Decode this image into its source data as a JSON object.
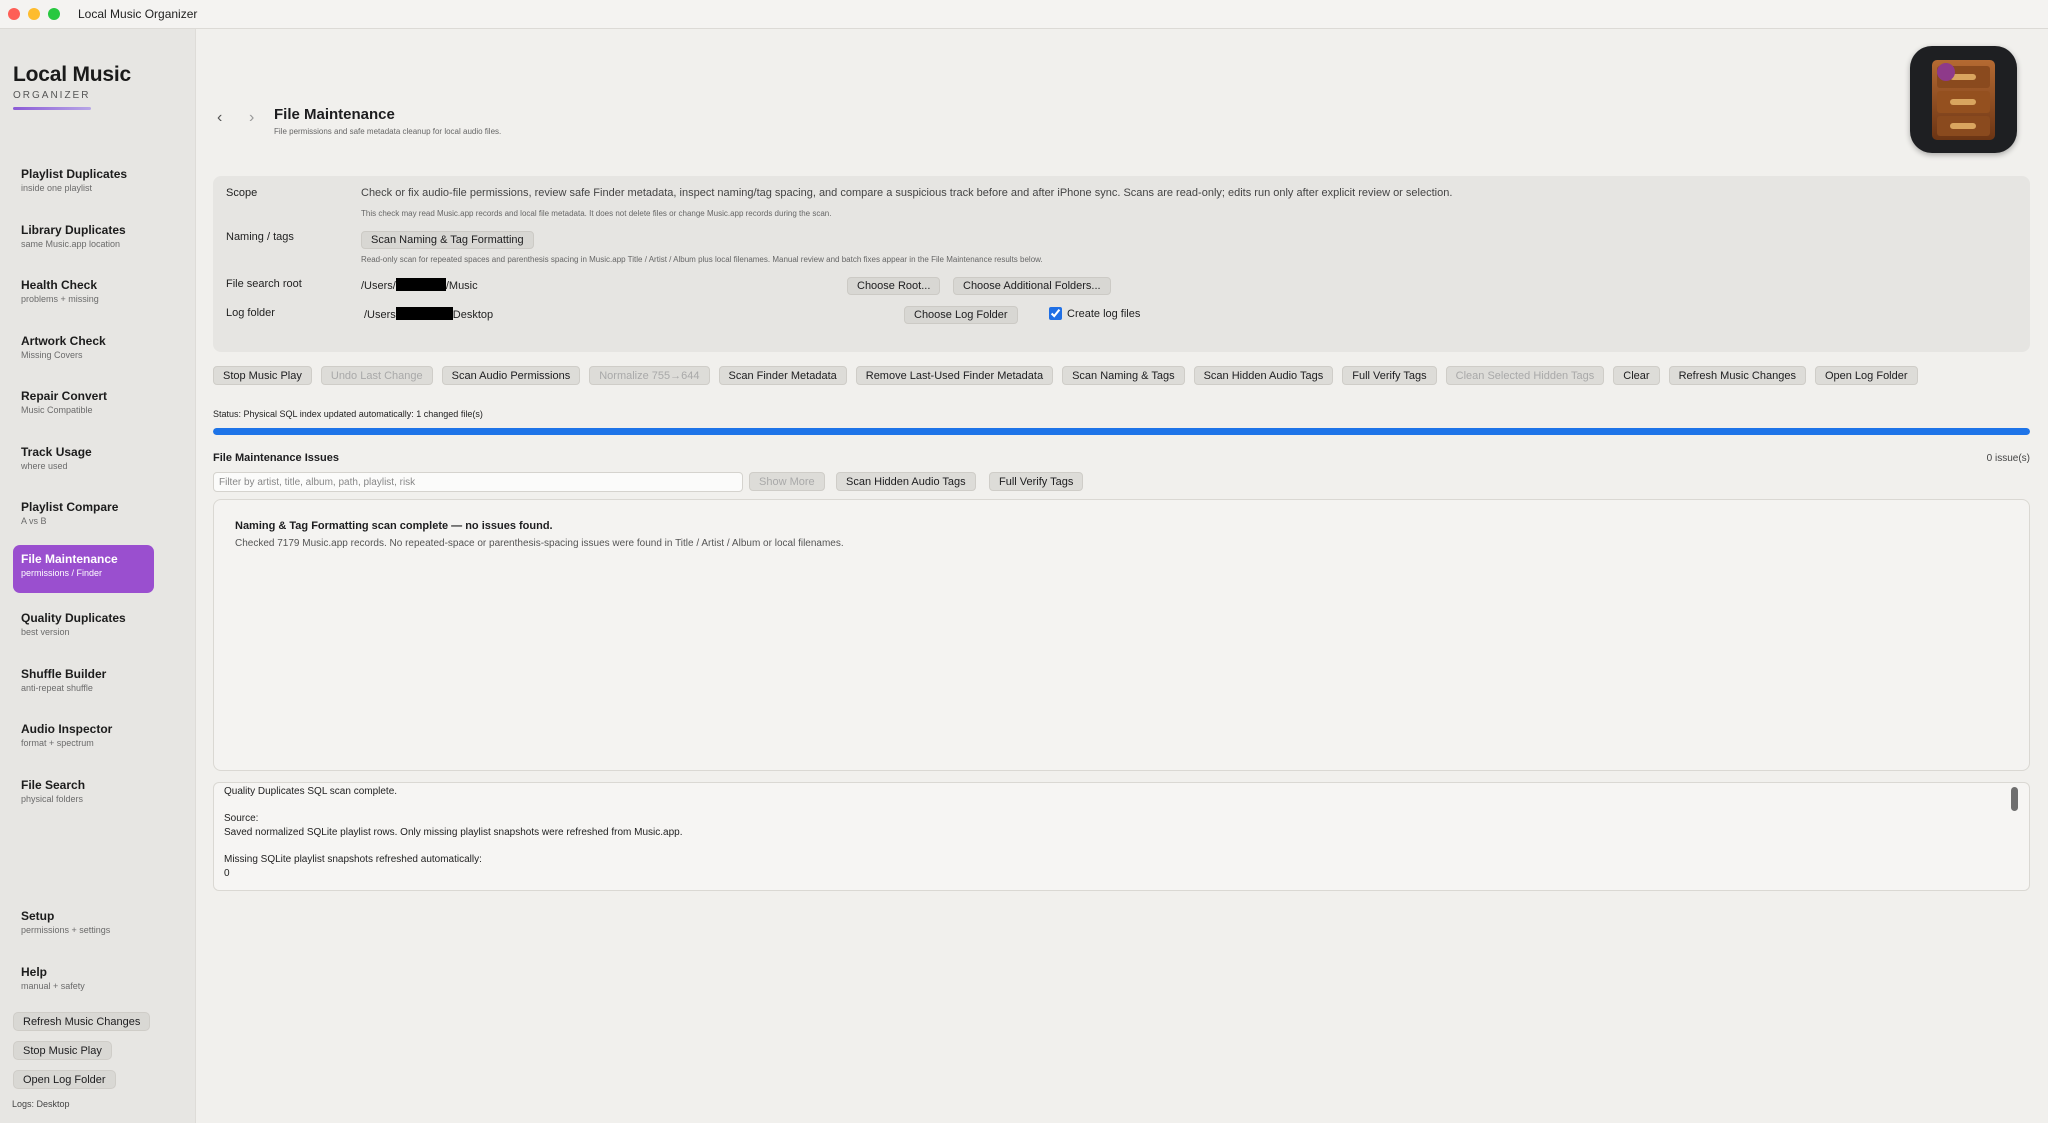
{
  "window": {
    "title": "Local Music Organizer"
  },
  "sidebar": {
    "brand_title": "Local Music",
    "brand_subtitle": "ORGANIZER",
    "items": [
      {
        "label": "Playlist Duplicates",
        "sub": "inside one playlist"
      },
      {
        "label": "Library Duplicates",
        "sub": "same Music.app location"
      },
      {
        "label": "Health Check",
        "sub": "problems + missing"
      },
      {
        "label": "Artwork Check",
        "sub": "Missing Covers"
      },
      {
        "label": "Repair Convert",
        "sub": "Music Compatible"
      },
      {
        "label": "Track Usage",
        "sub": "where used"
      },
      {
        "label": "Playlist Compare",
        "sub": "A vs B"
      },
      {
        "label": "File Maintenance",
        "sub": "permissions / Finder",
        "active": true
      },
      {
        "label": "Quality Duplicates",
        "sub": "best version"
      },
      {
        "label": "Shuffle Builder",
        "sub": "anti-repeat shuffle"
      },
      {
        "label": "Audio Inspector",
        "sub": "format + spectrum"
      },
      {
        "label": "File Search",
        "sub": "physical folders"
      }
    ],
    "footer_items": [
      {
        "label": "Setup",
        "sub": "permissions + settings"
      },
      {
        "label": "Help",
        "sub": "manual + safety"
      }
    ],
    "buttons": {
      "refresh": "Refresh Music Changes",
      "stop": "Stop Music Play",
      "open_log": "Open Log Folder"
    },
    "logs_label": "Logs: Desktop"
  },
  "header": {
    "title": "File Maintenance",
    "subtitle": "File permissions and safe metadata cleanup for local audio files.",
    "back_icon": "chevron-left-icon",
    "forward_icon": "chevron-right-icon"
  },
  "scope_panel": {
    "scope_label": "Scope",
    "scope_text": "Check or fix audio-file permissions, review safe Finder metadata, inspect naming/tag spacing, and compare a suspicious track before and after iPhone sync. Scans are read-only; edits run only after explicit review or selection.",
    "scope_note": "This check may read Music.app records and local file metadata. It does not delete files or change Music.app records during the scan.",
    "naming_label": "Naming / tags",
    "naming_button": "Scan Naming & Tag Formatting",
    "naming_note": "Read-only scan for repeated spaces and parenthesis spacing in Music.app Title / Artist / Album plus local filenames. Manual review and batch fixes appear in the File Maintenance results below.",
    "root_label": "File search root",
    "root_path_prefix": "/Users/",
    "root_path_suffix": "/Music",
    "choose_root": "Choose Root...",
    "choose_additional": "Choose Additional Folders...",
    "log_label": "Log folder",
    "log_path_prefix": "/Users",
    "log_path_suffix": "Desktop",
    "choose_log": "Choose Log Folder",
    "create_log_files": "Create log files",
    "create_log_files_checked": true
  },
  "toolbar": [
    {
      "label": "Stop Music Play",
      "enabled": true
    },
    {
      "label": "Undo Last Change",
      "enabled": false
    },
    {
      "label": "Scan Audio Permissions",
      "enabled": true
    },
    {
      "label": "Normalize 755→644",
      "enabled": false
    },
    {
      "label": "Scan Finder Metadata",
      "enabled": true
    },
    {
      "label": "Remove Last-Used Finder Metadata",
      "enabled": true
    },
    {
      "label": "Scan Naming & Tags",
      "enabled": true
    },
    {
      "label": "Scan Hidden Audio Tags",
      "enabled": true
    },
    {
      "label": "Full Verify Tags",
      "enabled": true
    },
    {
      "label": "Clean Selected Hidden Tags",
      "enabled": false
    },
    {
      "label": "Clear",
      "enabled": true
    },
    {
      "label": "Refresh Music Changes",
      "enabled": true
    },
    {
      "label": "Open Log Folder",
      "enabled": true
    }
  ],
  "status": {
    "text": "Status: Physical SQL index updated automatically: 1 changed file(s)",
    "progress": 1.0,
    "progress_color": "#1e74e8"
  },
  "issues": {
    "title": "File Maintenance Issues",
    "count": "0 issue(s)",
    "filter_placeholder": "Filter by artist, title, album, path, playlist, risk",
    "show_more": "Show More",
    "scan_hidden": "Scan Hidden Audio Tags",
    "full_verify": "Full Verify Tags",
    "result_title": "Naming & Tag Formatting scan complete — no issues found.",
    "result_body": "Checked 7179 Music.app records. No repeated-space or parenthesis-spacing issues were found in Title / Artist / Album or local filenames."
  },
  "log": {
    "lines": [
      "Quality Duplicates SQL scan complete.",
      "Source:",
      "Saved normalized SQLite playlist rows. Only missing playlist snapshots were refreshed from Music.app.",
      "Missing SQLite playlist snapshots refreshed automatically:",
      "0"
    ]
  },
  "colors": {
    "accent": "#9a4fcf",
    "progress": "#1e74e8"
  }
}
